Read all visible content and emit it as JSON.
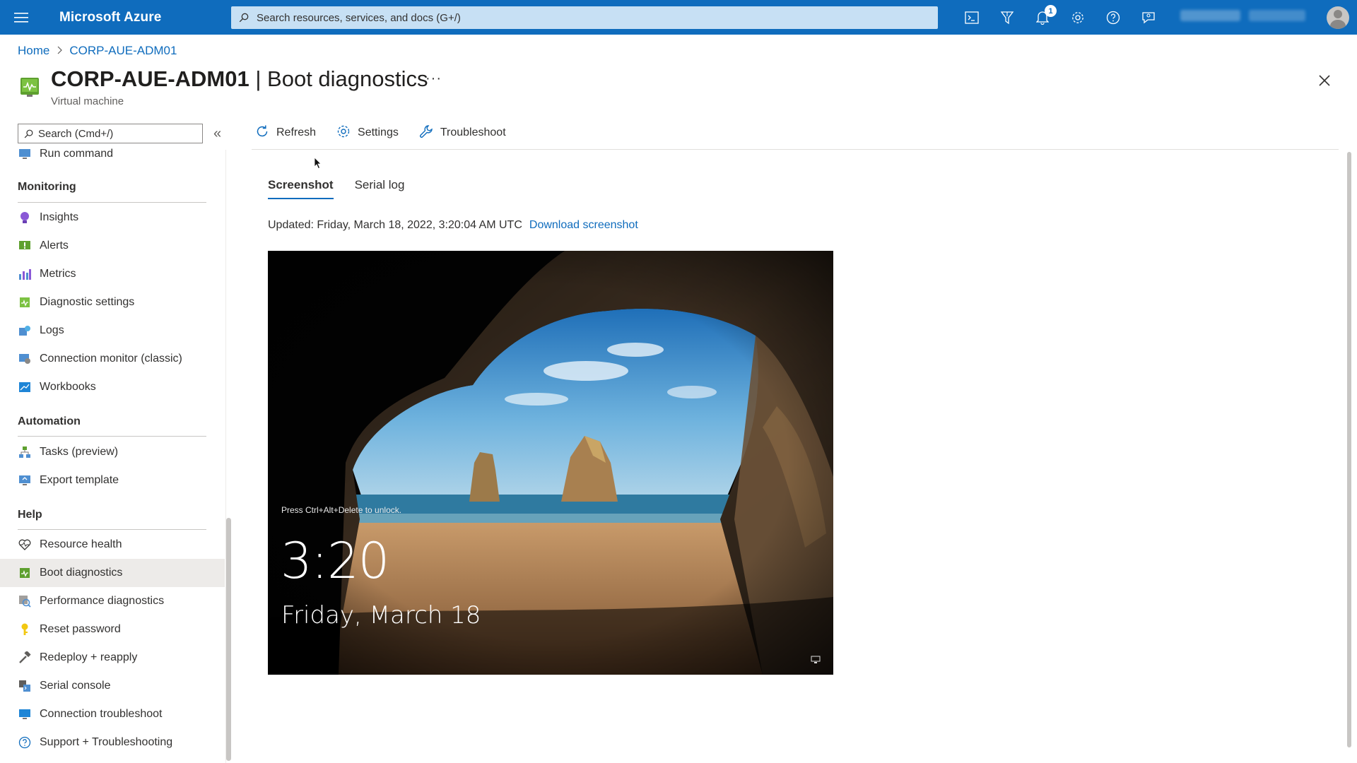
{
  "topbar": {
    "brand": "Microsoft Azure",
    "search_placeholder": "Search resources, services, and docs (G+/)",
    "notification_count": "1",
    "icons": [
      "cloud-shell-icon",
      "directory-filter-icon",
      "bell-icon",
      "gear-icon",
      "help-icon",
      "feedback-icon"
    ]
  },
  "breadcrumb": {
    "home": "Home",
    "resource": "CORP-AUE-ADM01"
  },
  "header": {
    "resource_name": "CORP-AUE-ADM01",
    "separator": " | ",
    "page": "Boot diagnostics",
    "subtitle": "Virtual machine",
    "more": "···"
  },
  "left_search": {
    "placeholder": "Search (Cmd+/)"
  },
  "sidebar": {
    "top_item": "Run command",
    "sections": {
      "monitoring": "Monitoring",
      "automation": "Automation",
      "help": "Help"
    },
    "monitoring_items": [
      "Insights",
      "Alerts",
      "Metrics",
      "Diagnostic settings",
      "Logs",
      "Connection monitor (classic)",
      "Workbooks"
    ],
    "automation_items": [
      "Tasks (preview)",
      "Export template"
    ],
    "help_items": [
      "Resource health",
      "Boot diagnostics",
      "Performance diagnostics",
      "Reset password",
      "Redeploy + reapply",
      "Serial console",
      "Connection troubleshoot",
      "Support + Troubleshooting"
    ],
    "active_item": "Boot diagnostics"
  },
  "toolbar": {
    "refresh": "Refresh",
    "settings": "Settings",
    "troubleshoot": "Troubleshoot"
  },
  "tabs": {
    "screenshot": "Screenshot",
    "serial_log": "Serial log"
  },
  "updated": {
    "text": "Updated: Friday, March 18, 2022, 3:20:04 AM UTC",
    "download": "Download screenshot"
  },
  "vm_screen": {
    "hint": "Press Ctrl+Alt+Delete to unlock.",
    "time": "3:20",
    "date": "Friday, March 18"
  },
  "colors": {
    "accent": "#0f6cbd",
    "active_bg": "#edebe9"
  }
}
